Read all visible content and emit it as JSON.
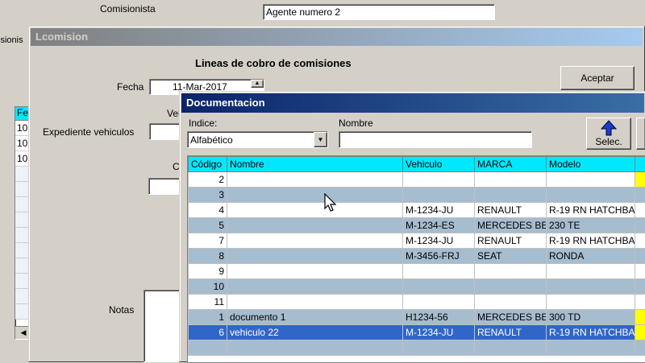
{
  "bg": {
    "comisionista_label": "Comisionista",
    "comisionista_value": "Agente numero 2",
    "left_cut_label": "isionis",
    "left_list": {
      "header": "Fe",
      "rows": [
        "10",
        "10",
        "10"
      ]
    }
  },
  "lcomision": {
    "title": "Lcomision",
    "heading": "Lineas de cobro de comisiones",
    "fecha_label": "Fecha",
    "fecha_value": "11-Mar-2017",
    "vehi_label": "Veh",
    "expediente_label": "Expediente vehiculos",
    "c_label": "C",
    "notas_label": "Notas",
    "aceptar_label": "Aceptar"
  },
  "documentacion": {
    "title": "Documentacion",
    "indice_label": "Indice:",
    "indice_value": "Alfabético",
    "nombre_label": "Nombre",
    "nombre_value": "",
    "selec_label": "Selec.",
    "columns": [
      "Código",
      "Nombre",
      "Vehiculo",
      "MARCA",
      "Modelo"
    ],
    "rows": [
      {
        "codigo": "2",
        "nombre": "",
        "vehiculo": "",
        "marca": "",
        "modelo": "",
        "mark": true
      },
      {
        "codigo": "3",
        "nombre": "",
        "vehiculo": "",
        "marca": "",
        "modelo": "",
        "mark": false
      },
      {
        "codigo": "4",
        "nombre": "",
        "vehiculo": "M-1234-JU",
        "marca": "RENAULT",
        "modelo": "R-19 RN HATCHBA",
        "mark": false
      },
      {
        "codigo": "5",
        "nombre": "",
        "vehiculo": "M-1234-ES",
        "marca": "MERCEDES BEN",
        "modelo": "230 TE",
        "mark": false
      },
      {
        "codigo": "7",
        "nombre": "",
        "vehiculo": "M-1234-JU",
        "marca": "RENAULT",
        "modelo": "R-19 RN HATCHBA",
        "mark": false
      },
      {
        "codigo": "8",
        "nombre": "",
        "vehiculo": "M-3456-FRJ",
        "marca": "SEAT",
        "modelo": "RONDA",
        "mark": false
      },
      {
        "codigo": "9",
        "nombre": "",
        "vehiculo": "",
        "marca": "",
        "modelo": "",
        "mark": false
      },
      {
        "codigo": "10",
        "nombre": "",
        "vehiculo": "",
        "marca": "",
        "modelo": "",
        "mark": false
      },
      {
        "codigo": "11",
        "nombre": "",
        "vehiculo": "",
        "marca": "",
        "modelo": "",
        "mark": false
      },
      {
        "codigo": "1",
        "nombre": "documento 1",
        "vehiculo": "H1234-56",
        "marca": "MERCEDES BEN",
        "modelo": "300 TD",
        "mark": true
      },
      {
        "codigo": "6",
        "nombre": "vehiculo 22",
        "vehiculo": "M-1234-JU",
        "marca": "RENAULT",
        "modelo": "R-19 RN HATCHBA",
        "mark": true
      },
      {
        "codigo": "",
        "nombre": "",
        "vehiculo": "",
        "marca": "",
        "modelo": "",
        "mark": false
      }
    ],
    "selected_index": 10,
    "colors": {
      "header": "#00e8ff",
      "alt_row": "#a6bccf",
      "selected": "#3166c9",
      "mark": "#ffff00"
    },
    "icons": {
      "selec": "arrow-up-icon",
      "dropdown": "chevron-down-icon"
    }
  }
}
